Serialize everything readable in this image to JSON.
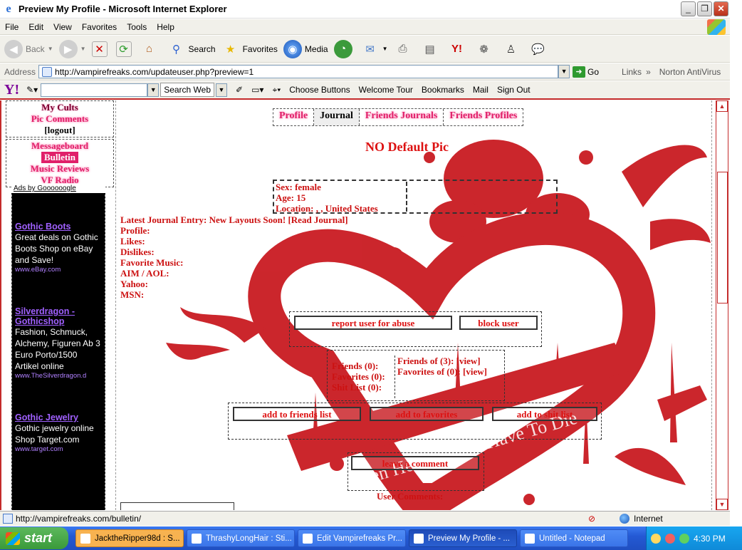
{
  "window": {
    "title": "Preview My Profile - Microsoft Internet Explorer",
    "controls": [
      "minimize",
      "maximize",
      "close"
    ]
  },
  "menu": [
    "File",
    "Edit",
    "View",
    "Favorites",
    "Tools",
    "Help"
  ],
  "toolbar": {
    "back": "Back",
    "search": "Search",
    "favorites": "Favorites",
    "media": "Media"
  },
  "address": {
    "label": "Address",
    "url": "http://vampirefreaks.com/updateuser.php?preview=1",
    "go": "Go",
    "links": "Links",
    "norton": "Norton AntiVirus"
  },
  "yahoo": {
    "logo": "Y!",
    "search_web": "Search Web",
    "items": [
      "Choose Buttons",
      "Welcome Tour",
      "Bookmarks",
      "Mail",
      "Sign Out"
    ]
  },
  "left": {
    "box1": [
      "My Cults",
      "Pic Comments",
      "[logout]"
    ],
    "box2": [
      "Messageboard",
      "Bulletin",
      "Music Reviews",
      "VF Radio"
    ],
    "ads_header": "Ads by Goooooogle",
    "ads": [
      {
        "title": "Gothic Boots",
        "desc": "Great deals on Gothic Boots Shop on eBay and Save!",
        "url": "www.eBay.com"
      },
      {
        "title": "Silverdragon - Gothicshop",
        "desc": "Fashion, Schmuck, Alchemy, Figuren Ab 3 Euro Porto/1500 Artikel online",
        "url": "www.TheSilverdragon.d"
      },
      {
        "title": "Gothic Jewelry",
        "desc": "Gothic jewelry online Shop Target.com",
        "url": "www.target.com"
      }
    ]
  },
  "profile": {
    "tabs": [
      "Profile",
      "Journal",
      "Friends Journals",
      "Friends Profiles"
    ],
    "no_pic": "NO Default Pic",
    "info_left": [
      "Sex: female",
      "Age: 15",
      "Location: , , United States"
    ],
    "details": [
      "Latest Journal Entry: New Layouts Soon! [Read Journal]",
      "Profile:",
      "Likes:",
      "Dislikes:",
      "Favorite Music:",
      "AIM / AOL:",
      "Yahoo:",
      "MSN:"
    ],
    "report_btn": "report user for abuse",
    "block_btn": "block user",
    "friends_left": [
      "Friends (0):",
      "Favorites (0):",
      "Shit List (0):"
    ],
    "friends_right": [
      "Friends of (3): [view]",
      "Favorites of (0): [view]"
    ],
    "add_friends": "add to friends list",
    "add_favorites": "add to favorites",
    "add_shit": "add to shit list",
    "leave_comment": "leave a comment",
    "user_comments": "User Comments:",
    "art_text": "Broken Hearts Don't Have To Die"
  },
  "status": {
    "url": "http://vampirefreaks.com/bulletin/",
    "zone": "Internet"
  },
  "taskbar": {
    "start": "start",
    "tasks": [
      "JacktheRipper98d : S...",
      "ThrashyLongHair : Sti...",
      "Edit Vampirefreaks Pr...",
      "Preview My Profile - ...",
      "Untitled - Notepad"
    ],
    "clock": "4:30 PM"
  },
  "colors": {
    "accent": "#c42b2b",
    "link_pink": "#e0206a",
    "xp_blue": "#2459d4"
  }
}
